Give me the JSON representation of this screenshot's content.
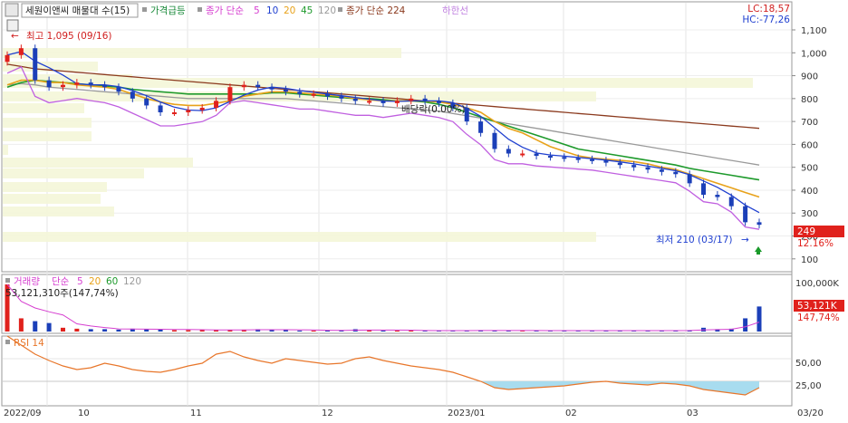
{
  "header": {
    "title": "세원이앤씨 매물대 수(15)",
    "legend_price": "가격급등",
    "legend_ma_label": "종가 단순",
    "ma_periods": [
      "5",
      "10",
      "20",
      "45",
      "120"
    ],
    "legend_ma224": "종가 단순 224",
    "legend_lowline": "하한선",
    "lc": "LC:18,57",
    "hc": "HC:-77,26"
  },
  "price_panel": {
    "high_annotation": "최고 1,095 (09/16)",
    "low_annotation": "최저 210 (03/17)",
    "dividend_annotation": "배당락(0.00%)",
    "current_price": "249",
    "current_change": "12.16%",
    "y_ticks": [
      "1,100",
      "1,000",
      "900",
      "800",
      "700",
      "600",
      "500",
      "400",
      "300",
      "200",
      "100"
    ]
  },
  "volume_panel": {
    "label": "거래량",
    "ma_label": "단순",
    "ma_periods": [
      "5",
      "20",
      "60",
      "120"
    ],
    "value_text": "53,121,310주(147,74%)",
    "y_tick_top": "100,000K",
    "current_value": "53,121K",
    "current_pct": "147,74%"
  },
  "rsi_panel": {
    "label": "RSI 14",
    "y_ticks": [
      "50,00",
      "25,00"
    ]
  },
  "x_axis": [
    "2022/09",
    "10",
    "11",
    "12",
    "2023/01",
    "02",
    "03",
    "03/20"
  ],
  "colors": {
    "up": "#e0211c",
    "down": "#1b3fb8",
    "ma5": "#d63fd0",
    "ma10": "#2040d0",
    "ma20": "#e8a21a",
    "ma45": "#1e9a2c",
    "ma120": "#9a9a9a",
    "ma224": "#8b3a1e",
    "lowline": "#c060e0",
    "rsi": "#e8762a",
    "rsi_fill": "#a8dcef"
  },
  "chart_data": [
    {
      "type": "candlestick",
      "title": "세원이앤씨",
      "x": [
        "2022/09",
        "10",
        "11",
        "12",
        "2023/01",
        "02",
        "03"
      ],
      "y_range": [
        100,
        1100
      ],
      "close_series": [
        990,
        1020,
        880,
        850,
        860,
        870,
        860,
        850,
        830,
        800,
        770,
        740,
        740,
        750,
        760,
        790,
        850,
        860,
        850,
        840,
        830,
        820,
        820,
        810,
        800,
        790,
        790,
        780,
        790,
        800,
        790,
        780,
        760,
        700,
        650,
        580,
        560,
        560,
        550,
        545,
        540,
        535,
        530,
        520,
        510,
        500,
        490,
        480,
        470,
        430,
        380,
        370,
        330,
        260,
        249
      ],
      "ma20": [
        860,
        880,
        880,
        870,
        870,
        860,
        855,
        850,
        840,
        820,
        800,
        785,
        775,
        770,
        770,
        780,
        790,
        810,
        820,
        830,
        830,
        825,
        820,
        815,
        810,
        800,
        795,
        790,
        790,
        790,
        790,
        785,
        775,
        760,
        740,
        700,
        670,
        650,
        620,
        590,
        570,
        550,
        540,
        535,
        530,
        525,
        515,
        500,
        490,
        470,
        450,
        430,
        410,
        390,
        370
      ],
      "ma45": [
        850,
        870,
        880,
        875,
        870,
        865,
        860,
        855,
        850,
        840,
        835,
        830,
        825,
        820,
        820,
        820,
        820,
        820,
        820,
        825,
        825,
        820,
        815,
        810,
        805,
        800,
        800,
        795,
        790,
        790,
        785,
        775,
        760,
        740,
        720,
        700,
        680,
        660,
        640,
        620,
        600,
        580,
        570,
        560,
        550,
        540,
        530,
        520,
        510,
        495,
        485,
        475,
        465,
        455,
        445
      ],
      "ma120": [
        860,
        865,
        860,
        850,
        845,
        840,
        835,
        830,
        825,
        820,
        815,
        810,
        805,
        800,
        800,
        800,
        800,
        800,
        800,
        800,
        800,
        795,
        790,
        785,
        780,
        775,
        770,
        765,
        760,
        755,
        750,
        745,
        735,
        725,
        715,
        700,
        690,
        680,
        670,
        660,
        650,
        640,
        630,
        620,
        610,
        600,
        590,
        580,
        570,
        560,
        550,
        540,
        530,
        520,
        510
      ],
      "ma224": [
        950,
        940,
        930,
        925,
        920,
        915,
        910,
        905,
        900,
        895,
        890,
        885,
        880,
        875,
        870,
        865,
        860,
        855,
        850,
        845,
        840,
        835,
        830,
        825,
        820,
        815,
        810,
        805,
        800,
        795,
        790,
        785,
        780,
        775,
        770,
        765,
        760,
        755,
        750,
        745,
        740,
        735,
        730,
        725,
        720,
        715,
        710,
        705,
        700,
        695,
        690,
        685,
        680,
        675,
        670
      ],
      "high": 1095,
      "high_date": "09/16",
      "low": 210,
      "low_date": "03/17",
      "last": 249,
      "last_change_pct": 12.16
    },
    {
      "type": "bar",
      "title": "거래량",
      "y_range": [
        0,
        100000
      ],
      "unit": "K",
      "values": [
        100000,
        28000,
        22000,
        18000,
        8000,
        6000,
        5000,
        5000,
        4000,
        6000,
        5000,
        4000,
        3000,
        3000,
        4000,
        3000,
        3000,
        4000,
        5000,
        4000,
        3000,
        2000,
        2000,
        2000,
        3000,
        5000,
        3000,
        2000,
        2000,
        2000,
        2000,
        2000,
        2000,
        2000,
        3000,
        2000,
        2000,
        2000,
        2000,
        2000,
        2000,
        2000,
        2000,
        2000,
        2000,
        2000,
        2000,
        2000,
        2000,
        3000,
        8000,
        5000,
        6000,
        28000,
        53121
      ],
      "last": 53121,
      "last_pct": 147.74
    },
    {
      "type": "area",
      "title": "RSI 14",
      "y_range": [
        0,
        100
      ],
      "threshold": 25,
      "values": [
        75,
        65,
        55,
        48,
        42,
        38,
        40,
        45,
        42,
        38,
        36,
        35,
        38,
        42,
        45,
        55,
        58,
        52,
        48,
        45,
        50,
        48,
        46,
        44,
        45,
        50,
        52,
        48,
        45,
        42,
        40,
        38,
        35,
        30,
        25,
        18,
        16,
        17,
        18,
        19,
        20,
        22,
        24,
        25,
        23,
        22,
        21,
        23,
        22,
        20,
        16,
        14,
        12,
        10,
        18
      ]
    }
  ]
}
